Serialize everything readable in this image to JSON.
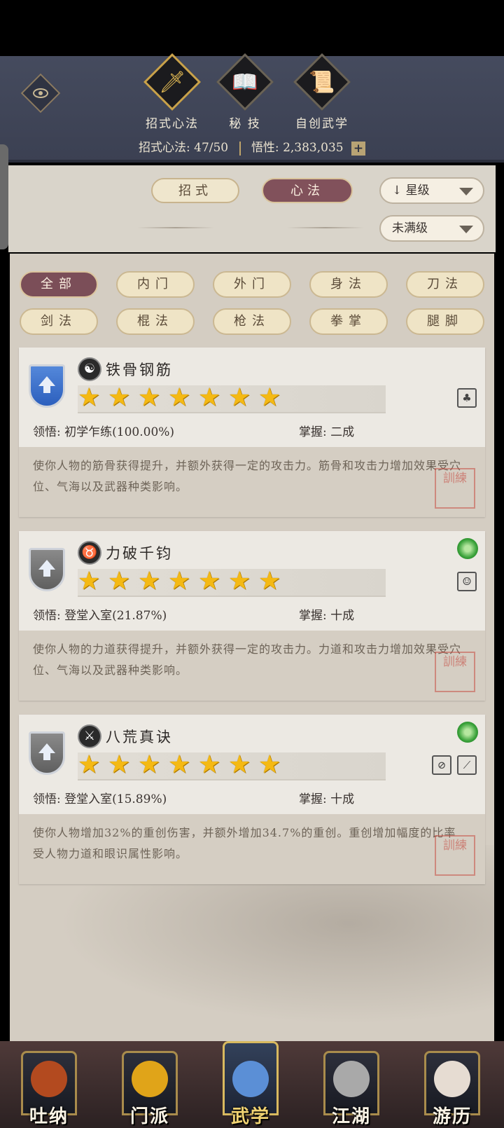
{
  "main_tabs": [
    {
      "label": "招式心法",
      "icon": "sword-icon",
      "glyph": "🗡",
      "active": true
    },
    {
      "label": "秘 技",
      "icon": "book-icon",
      "glyph": "📖",
      "active": false
    },
    {
      "label": "自创武学",
      "icon": "scroll-icon",
      "glyph": "📜",
      "active": false
    }
  ],
  "stats": {
    "techniques_label": "招式心法:",
    "techniques_value": "47/50",
    "insight_label": "悟性:",
    "insight_value": "2,383,035",
    "plus": "+"
  },
  "sub_tabs": {
    "moves": "招式",
    "mental": "心法"
  },
  "sort": {
    "label": "星级",
    "arrow": "↓"
  },
  "level_filter": {
    "label": "未满级"
  },
  "filters": [
    "全部",
    "内门",
    "外门",
    "身法",
    "刀法",
    "剑法",
    "棍法",
    "枪法",
    "拳掌",
    "腿脚"
  ],
  "active_filter": "全部",
  "skills": [
    {
      "name": "铁骨钢筋",
      "type_icon": "yin-yang-icon",
      "type_glyph": "☯",
      "shield": "blue",
      "stars": 7,
      "comprehension_label": "领悟:",
      "comprehension": "初学乍练(100.00%)",
      "mastery_label": "掌握:",
      "mastery": "二成",
      "description": "使你人物的筋骨获得提升，并额外获得一定的攻击力。筋骨和攻击力增加效果受穴位、气海以及武器种类影响。",
      "gems": [
        "♣"
      ],
      "swirl": false
    },
    {
      "name": "力破千钧",
      "type_icon": "bull-icon",
      "type_glyph": "♉",
      "shield": "grey",
      "stars": 7,
      "comprehension_label": "领悟:",
      "comprehension": "登堂入室(21.87%)",
      "mastery_label": "掌握:",
      "mastery": "十成",
      "description": "使你人物的力道获得提升，并额外获得一定的攻击力。力道和攻击力增加效果受穴位、气海以及武器种类影响。",
      "gems": [
        "☺"
      ],
      "swirl": true
    },
    {
      "name": "八荒真诀",
      "type_icon": "crossed-swords-icon",
      "type_glyph": "⚔",
      "shield": "grey",
      "stars": 7,
      "comprehension_label": "领悟:",
      "comprehension": "登堂入室(15.89%)",
      "mastery_label": "掌握:",
      "mastery": "十成",
      "description": "使你人物增加32%的重创伤害，并额外增加34.7%的重创。重创增加幅度的比率受人物力道和眼识属性影响。",
      "gems": [
        "⊘",
        "⟋"
      ],
      "swirl": true
    }
  ],
  "seal_text": "訓練",
  "bottom_nav": [
    {
      "label": "吐纳",
      "icon": "monk-icon",
      "color": "#b34a1f",
      "active": false
    },
    {
      "label": "门派",
      "icon": "banner-icon",
      "color": "#e0a419",
      "active": false
    },
    {
      "label": "武学",
      "icon": "books-icon",
      "color": "#5b8fd6",
      "active": true
    },
    {
      "label": "江湖",
      "icon": "hat-icon",
      "color": "#a9a9a9",
      "active": false
    },
    {
      "label": "游历",
      "icon": "horse-icon",
      "color": "#e6dcd2",
      "active": false
    }
  ]
}
